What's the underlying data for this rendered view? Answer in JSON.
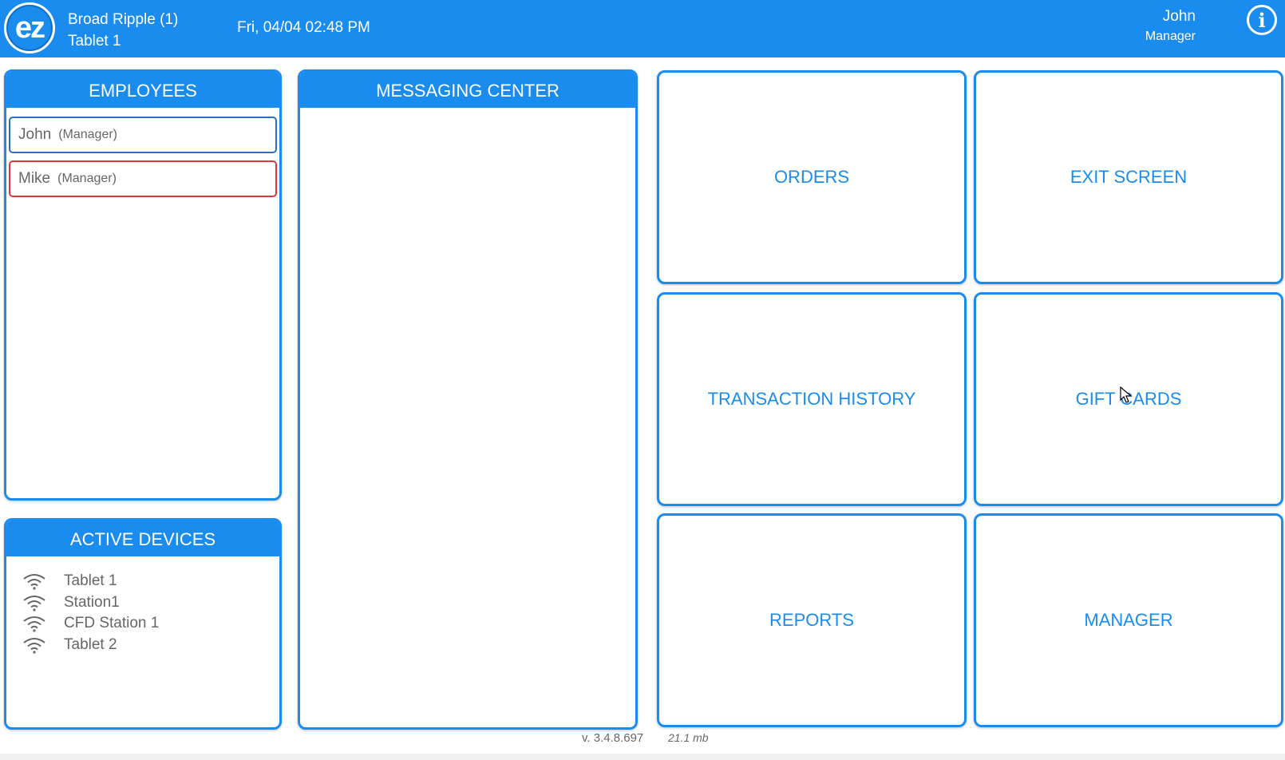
{
  "header": {
    "logo_text": "ez",
    "location": "Broad Ripple (1)",
    "device": "Tablet 1",
    "datetime": "Fri, 04/04 02:48 PM",
    "user_name": "John",
    "user_role": "Manager",
    "info_icon": "info-icon"
  },
  "colors": {
    "brand_blue": "#1a8cf0",
    "active_border": "#2b6fc4",
    "alert_border": "#d9383a"
  },
  "employees": {
    "title": "EMPLOYEES",
    "items": [
      {
        "name": "John",
        "role": "(Manager)"
      },
      {
        "name": "Mike",
        "role": "(Manager)"
      }
    ]
  },
  "devices": {
    "title": "ACTIVE DEVICES",
    "items": [
      {
        "name": "Tablet 1",
        "icon": "wifi-icon"
      },
      {
        "name": "Station1",
        "icon": "wifi-icon"
      },
      {
        "name": "CFD Station 1",
        "icon": "wifi-icon"
      },
      {
        "name": "Tablet 2",
        "icon": "wifi-icon"
      }
    ]
  },
  "messaging": {
    "title": "MESSAGING CENTER"
  },
  "tiles": {
    "orders": "ORDERS",
    "exit_screen": "EXIT SCREEN",
    "transaction_history": "TRANSACTION HISTORY",
    "gift_cards": "GIFT CARDS",
    "reports": "REPORTS",
    "manager": "MANAGER"
  },
  "footer": {
    "version": "v. 3.4.8.697",
    "memory": "21.1  mb"
  }
}
